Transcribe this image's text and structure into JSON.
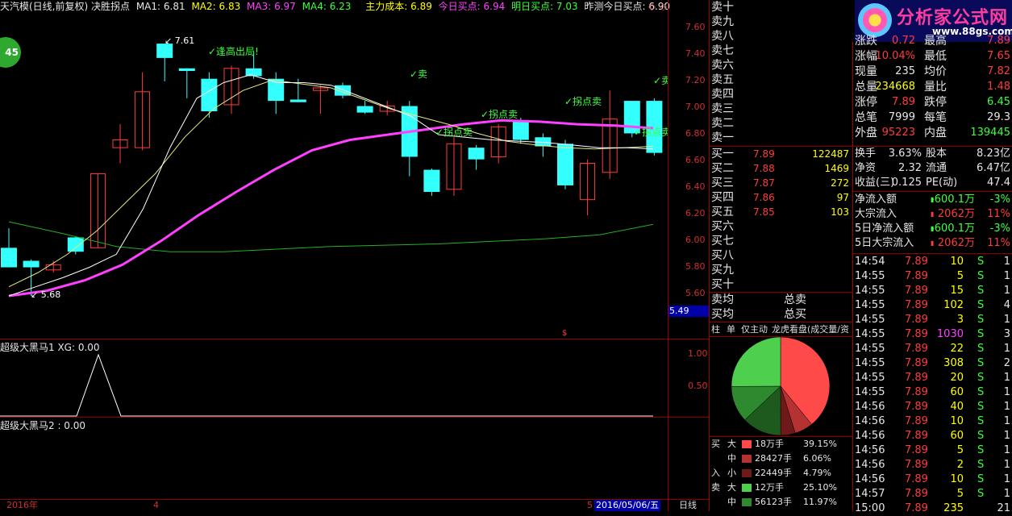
{
  "header": {
    "title": "天汽模(日线,前复权) 决胜拐点",
    "ma1_label": "MA1: 6.81",
    "ma2_label": "MA2: 6.83",
    "ma3_label": "MA3: 6.97",
    "ma4_label": "MA4: 6.23",
    "main_cost": "主力成本: 6.89",
    "today_buy": "今日买点: 6.94",
    "tomorrow_buy": "明日买点: 7.03",
    "yest_pred": "昨测今日买点: 6.90",
    "colors": {
      "ma1": "#ffffff",
      "ma2": "#ffff00",
      "ma3": "#ff40ff",
      "ma4": "#3cff3c",
      "accent": "#ff0000"
    }
  },
  "badge": "45",
  "chart": {
    "y_ticks": [
      "7.60",
      "7.40",
      "7.20",
      "7.00",
      "6.80",
      "6.60",
      "6.40",
      "6.20",
      "6.00",
      "5.80",
      "5.60"
    ],
    "current_price": "5.49",
    "high_label": "7.61",
    "low_label": "5.68",
    "signals": [
      "逢高出局!",
      "卖",
      "拐点卖",
      "拐点卖",
      "拐点卖",
      "拐点卖",
      "卖",
      "卖"
    ],
    "dollar": "$"
  },
  "chart_data": {
    "type": "candlestick",
    "y_range": [
      5.6,
      7.7
    ],
    "candles": [
      {
        "o": 5.9,
        "c": 6.05,
        "h": 6.2,
        "l": 5.9,
        "up": false
      },
      {
        "o": 5.95,
        "c": 5.9,
        "h": 5.96,
        "l": 5.68,
        "up": false
      },
      {
        "o": 5.88,
        "c": 5.92,
        "h": 5.95,
        "l": 5.86,
        "up": true
      },
      {
        "o": 6.13,
        "c": 6.02,
        "h": 6.14,
        "l": 6.0,
        "up": false
      },
      {
        "o": 6.05,
        "c": 6.62,
        "h": 6.62,
        "l": 6.05,
        "up": true
      },
      {
        "o": 6.82,
        "c": 6.88,
        "h": 7.0,
        "l": 6.7,
        "up": true
      },
      {
        "o": 6.82,
        "c": 7.25,
        "h": 7.4,
        "l": 6.8,
        "up": true
      },
      {
        "o": 7.62,
        "c": 7.51,
        "h": 7.62,
        "l": 7.33,
        "up": false
      },
      {
        "o": 7.43,
        "c": 7.41,
        "h": 7.43,
        "l": 7.2,
        "up": false
      },
      {
        "o": 7.35,
        "c": 7.1,
        "h": 7.4,
        "l": 7.05,
        "up": false
      },
      {
        "o": 7.15,
        "c": 7.43,
        "h": 7.45,
        "l": 7.08,
        "up": true
      },
      {
        "o": 7.43,
        "c": 7.37,
        "h": 7.55,
        "l": 7.35,
        "up": false
      },
      {
        "o": 7.35,
        "c": 7.18,
        "h": 7.4,
        "l": 7.08,
        "up": false
      },
      {
        "o": 7.19,
        "c": 7.17,
        "h": 7.35,
        "l": 7.17,
        "up": false
      },
      {
        "o": 7.28,
        "c": 7.26,
        "h": 7.3,
        "l": 7.08,
        "up": true
      },
      {
        "o": 7.3,
        "c": 7.22,
        "h": 7.32,
        "l": 7.2,
        "up": false
      },
      {
        "o": 7.14,
        "c": 7.09,
        "h": 7.18,
        "l": 7.08,
        "up": false
      },
      {
        "o": 7.1,
        "c": 7.14,
        "h": 7.18,
        "l": 7.07,
        "up": true
      },
      {
        "o": 7.14,
        "c": 6.75,
        "h": 7.18,
        "l": 6.6,
        "up": false
      },
      {
        "o": 6.65,
        "c": 6.48,
        "h": 6.66,
        "l": 6.45,
        "up": false
      },
      {
        "o": 6.5,
        "c": 6.85,
        "h": 6.9,
        "l": 6.45,
        "up": true
      },
      {
        "o": 6.82,
        "c": 6.73,
        "h": 6.84,
        "l": 6.65,
        "up": false
      },
      {
        "o": 6.75,
        "c": 6.98,
        "h": 7.0,
        "l": 6.7,
        "up": true
      },
      {
        "o": 7.02,
        "c": 6.88,
        "h": 7.05,
        "l": 6.85,
        "up": false
      },
      {
        "o": 6.9,
        "c": 6.83,
        "h": 6.93,
        "l": 6.75,
        "up": false
      },
      {
        "o": 6.85,
        "c": 6.53,
        "h": 6.88,
        "l": 6.5,
        "up": false
      },
      {
        "o": 6.42,
        "c": 6.7,
        "h": 6.73,
        "l": 6.3,
        "up": true
      },
      {
        "o": 6.63,
        "c": 7.04,
        "h": 7.26,
        "l": 6.58,
        "up": true
      },
      {
        "o": 6.93,
        "c": 7.18,
        "h": 7.18,
        "l": 6.9,
        "up": false
      },
      {
        "o": 7.18,
        "c": 6.78,
        "h": 7.2,
        "l": 6.76,
        "up": false
      }
    ],
    "ma_white": [
      5.68,
      5.75,
      5.82,
      5.9,
      6.0,
      6.35,
      6.82,
      7.2,
      7.32,
      7.38,
      7.32,
      7.32,
      7.3,
      7.22,
      7.14,
      7.06,
      6.92,
      6.9,
      6.88,
      6.87,
      6.86,
      6.84,
      6.82,
      6.82,
      6.81
    ],
    "ma_yellow": [
      5.75,
      5.86,
      6.0,
      6.18,
      6.4,
      6.62,
      6.9,
      7.12,
      7.26,
      7.34,
      7.31,
      7.28,
      7.2,
      7.12,
      7.06,
      7.0,
      6.93,
      6.87,
      6.84,
      6.82,
      6.81,
      6.82,
      6.83
    ],
    "ma_magenta": [
      5.68,
      5.72,
      5.8,
      5.92,
      6.1,
      6.3,
      6.48,
      6.65,
      6.8,
      6.88,
      6.92,
      6.96,
      7.0,
      7.03,
      7.02,
      7.0,
      6.99,
      6.97
    ],
    "ma_green": [
      6.25,
      6.16,
      6.06,
      6.02,
      6.02,
      6.04,
      6.06,
      6.07,
      6.08,
      6.1,
      6.12,
      6.15,
      6.23
    ]
  },
  "indicator1": {
    "title": "超级大黑马1 XG: 0.00",
    "ticks": [
      "1.00",
      "0.50"
    ]
  },
  "indicator2": {
    "title": "超级大黑马2 : 0.00"
  },
  "bottom_bar": {
    "year": "2016年",
    "m4": "4",
    "m5": "5",
    "date": "2016/05/06/五",
    "period": "日线"
  },
  "sell_book": [
    "卖十",
    "卖九",
    "卖八",
    "卖七",
    "卖六",
    "卖五",
    "卖四",
    "卖三",
    "卖二",
    "卖一"
  ],
  "buy_book": [
    {
      "label": "买一",
      "price": "7.89",
      "vol": "122487"
    },
    {
      "label": "买二",
      "price": "7.88",
      "vol": "1469"
    },
    {
      "label": "买三",
      "price": "7.87",
      "vol": "272"
    },
    {
      "label": "买四",
      "price": "7.86",
      "vol": "97"
    },
    {
      "label": "买五",
      "price": "7.85",
      "vol": "103"
    },
    {
      "label": "买六",
      "price": "",
      "vol": ""
    },
    {
      "label": "买七",
      "price": "",
      "vol": ""
    },
    {
      "label": "买八",
      "price": "",
      "vol": ""
    },
    {
      "label": "买九",
      "price": "",
      "vol": ""
    },
    {
      "label": "买十",
      "price": "",
      "vol": ""
    }
  ],
  "avg_rows": [
    {
      "a": "卖均",
      "b": "总卖"
    },
    {
      "a": "买均",
      "b": "总买"
    }
  ],
  "tabs": [
    "柱",
    "单",
    "仅主动",
    "龙虎看盘(成交量/资"
  ],
  "pie": {
    "slices": [
      {
        "name": "大买",
        "pct": 39.15,
        "color": "#ff4a4a"
      },
      {
        "name": "中买",
        "pct": 6.06,
        "color": "#b43232"
      },
      {
        "name": "小买",
        "pct": 4.79,
        "color": "#6e1a1a"
      },
      {
        "name": "小卖",
        "pct": 13.0,
        "color": "#1e5a1e"
      },
      {
        "name": "中卖",
        "pct": 11.97,
        "color": "#2f8a2f"
      },
      {
        "name": "大卖",
        "pct": 25.1,
        "color": "#4ed04e"
      }
    ]
  },
  "flow_legend": [
    {
      "side": "买",
      "size": "大",
      "vol": "18万手",
      "pct": "39.15%",
      "color": "#ff4a4a"
    },
    {
      "side": "",
      "size": "中",
      "vol": "28427手",
      "pct": "6.06%",
      "color": "#b43232"
    },
    {
      "side": "入",
      "size": "小",
      "vol": "22449手",
      "pct": "4.79%",
      "color": "#6e1a1a"
    },
    {
      "side": "卖",
      "size": "大",
      "vol": "12万手",
      "pct": "25.10%",
      "color": "#4ed04e"
    },
    {
      "side": "",
      "size": "中",
      "vol": "56123手",
      "pct": "11.97%",
      "color": "#2f8a2f"
    }
  ],
  "logo": {
    "text": "分析家公式网",
    "url": "www.88gs.com"
  },
  "quote": [
    {
      "l": "涨跌",
      "v": "0.72",
      "l2": "最高",
      "v2": "7.89",
      "c": "red",
      "c2": "red"
    },
    {
      "l": "涨幅",
      "v": "10.04%",
      "l2": "最低",
      "v2": "7.65",
      "c": "red",
      "c2": "red"
    },
    {
      "l": "现量",
      "v": "235",
      "l2": "均价",
      "v2": "7.82",
      "c": "wht",
      "c2": "red"
    },
    {
      "l": "总量",
      "v": "234668",
      "l2": "量比",
      "v2": "1.48",
      "c": "yel",
      "c2": "red"
    },
    {
      "l": "涨停",
      "v": "7.89",
      "l2": "跌停",
      "v2": "6.45",
      "c": "red",
      "c2": "grn"
    },
    {
      "l": "总笔",
      "v": "7999",
      "l2": "每笔",
      "v2": "29.3",
      "c": "wht",
      "c2": "wht"
    },
    {
      "l": "外盘",
      "v": "95223",
      "l2": "内盘",
      "v2": "139445",
      "c": "red",
      "c2": "grn"
    }
  ],
  "stats": [
    {
      "l": "换手",
      "v": "3.63%",
      "l2": "股本",
      "v2": "8.23亿"
    },
    {
      "l": "净资",
      "v": "2.32",
      "l2": "流通",
      "v2": "6.47亿"
    },
    {
      "l": "收益(三)",
      "v": "0.125",
      "l2": "PE(动)",
      "v2": "47.4"
    }
  ],
  "flows": [
    {
      "l": "净流入额",
      "v": "-600.1万",
      "p": "-3%",
      "c": "grn"
    },
    {
      "l": "大宗流入",
      "v": "2062万",
      "p": "11%",
      "c": "red"
    },
    {
      "l": "5日净流入额",
      "v": "-600.1万",
      "p": "-3%",
      "c": "grn"
    },
    {
      "l": "5日大宗流入",
      "v": "2062万",
      "p": "11%",
      "c": "red"
    }
  ],
  "ticks": [
    {
      "t": "14:54",
      "p": "7.89",
      "v": "10",
      "s": "S",
      "n": "1",
      "vc": "yel"
    },
    {
      "t": "14:55",
      "p": "7.89",
      "v": "5",
      "s": "S",
      "n": "1",
      "vc": "yel"
    },
    {
      "t": "14:55",
      "p": "7.89",
      "v": "15",
      "s": "S",
      "n": "1",
      "vc": "yel"
    },
    {
      "t": "14:55",
      "p": "7.89",
      "v": "102",
      "s": "S",
      "n": "4",
      "vc": "yel"
    },
    {
      "t": "14:55",
      "p": "7.89",
      "v": "3",
      "s": "S",
      "n": "1",
      "vc": "yel"
    },
    {
      "t": "14:55",
      "p": "7.89",
      "v": "1030",
      "s": "S",
      "n": "3",
      "vc": "mag"
    },
    {
      "t": "14:55",
      "p": "7.89",
      "v": "22",
      "s": "S",
      "n": "1",
      "vc": "yel"
    },
    {
      "t": "14:55",
      "p": "7.89",
      "v": "308",
      "s": "S",
      "n": "2",
      "vc": "yel"
    },
    {
      "t": "14:55",
      "p": "7.89",
      "v": "20",
      "s": "S",
      "n": "1",
      "vc": "yel"
    },
    {
      "t": "14:55",
      "p": "7.89",
      "v": "60",
      "s": "S",
      "n": "1",
      "vc": "yel"
    },
    {
      "t": "14:56",
      "p": "7.89",
      "v": "40",
      "s": "S",
      "n": "1",
      "vc": "yel"
    },
    {
      "t": "14:56",
      "p": "7.89",
      "v": "10",
      "s": "S",
      "n": "1",
      "vc": "yel"
    },
    {
      "t": "14:56",
      "p": "7.89",
      "v": "60",
      "s": "S",
      "n": "1",
      "vc": "yel"
    },
    {
      "t": "14:56",
      "p": "7.89",
      "v": "5",
      "s": "S",
      "n": "1",
      "vc": "yel"
    },
    {
      "t": "14:56",
      "p": "7.89",
      "v": "2",
      "s": "S",
      "n": "1",
      "vc": "yel"
    },
    {
      "t": "14:56",
      "p": "7.89",
      "v": "10",
      "s": "S",
      "n": "1",
      "vc": "yel"
    },
    {
      "t": "14:57",
      "p": "7.89",
      "v": "5",
      "s": "S",
      "n": "1",
      "vc": "yel"
    },
    {
      "t": "15:00",
      "p": "7.89",
      "v": "235",
      "s": "",
      "n": "21",
      "vc": "yel"
    }
  ]
}
